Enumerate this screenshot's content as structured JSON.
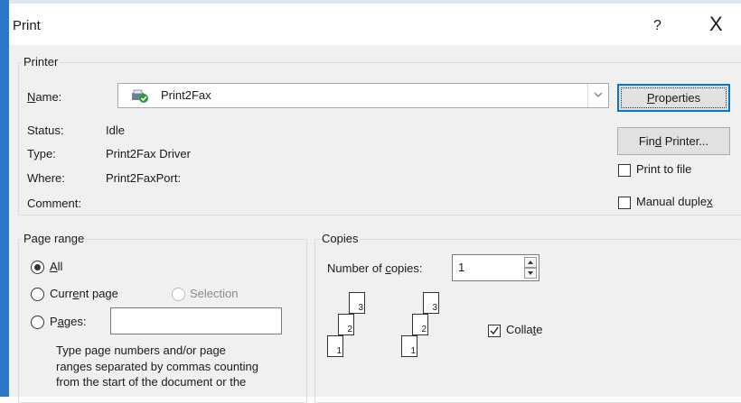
{
  "window": {
    "title": "Print",
    "help_glyph": "?",
    "close_glyph": "X"
  },
  "printer": {
    "group_label": "Printer",
    "name_label": "Name:",
    "name_value": "Print2Fax",
    "status_label": "Status:",
    "status_value": "Idle",
    "type_label": "Type:",
    "type_value": "Print2Fax Driver",
    "where_label": "Where:",
    "where_value": "Print2FaxPort:",
    "comment_label": "Comment:",
    "comment_value": "",
    "properties_button": "Properties",
    "find_printer_button": "Find Printer...",
    "print_to_file_label": "Print to file",
    "print_to_file_checked": false,
    "manual_duplex_label": "Manual duplex",
    "manual_duplex_checked": false
  },
  "page_range": {
    "group_label": "Page range",
    "all_label": "All",
    "all_selected": true,
    "current_page_label": "Current page",
    "selection_label": "Selection",
    "selection_enabled": false,
    "pages_label": "Pages:",
    "pages_value": "",
    "help_line1": "Type page numbers and/or page",
    "help_line2": "ranges separated by commas counting",
    "help_line3": "from the start of the document or the"
  },
  "copies": {
    "group_label": "Copies",
    "number_label": "Number of copies:",
    "number_value": "1",
    "collate_label": "Collate",
    "collate_checked": true,
    "sheet_numbers": [
      "1",
      "2",
      "3"
    ]
  },
  "icons": {
    "printer": "fax-printer-icon",
    "close": "close-icon",
    "dropdown": "chevron-down-icon",
    "spin_up": "spin-up-icon",
    "spin_down": "spin-down-icon"
  },
  "colors": {
    "accent": "#0078d7",
    "window_border": "#2b78c8",
    "client_bg": "#f0f0f0"
  }
}
